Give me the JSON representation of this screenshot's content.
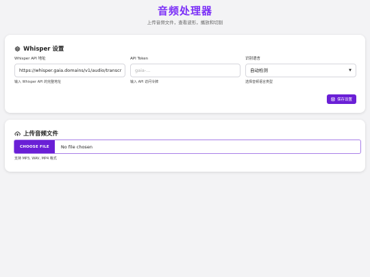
{
  "header": {
    "title": "音频处理器",
    "subtitle": "上传音频文件，查看波形，播放和切割"
  },
  "settings": {
    "title": "Whisper 设置",
    "api_url": {
      "label": "Whisper API 地址",
      "value": "https://whisper.gaia.domains/v1/audio/transcr",
      "hint": "输入 Whisper API 的完整地址"
    },
    "api_token": {
      "label": "API Token",
      "placeholder": "gaia-...",
      "hint": "输入 API 访问令牌"
    },
    "language": {
      "label": "识别语言",
      "selected": "自动检测",
      "hint": "选择音频语言类型"
    },
    "save_label": "保存设置"
  },
  "upload": {
    "title": "上传音频文件",
    "choose_label": "CHOOSE FILE",
    "status": "No file chosen",
    "hint": "支持 MP3, WAV, MP4 格式"
  },
  "colors": {
    "accent": "#7b2ff7",
    "button": "#6a1fd6",
    "background": "#f3f3f5"
  }
}
